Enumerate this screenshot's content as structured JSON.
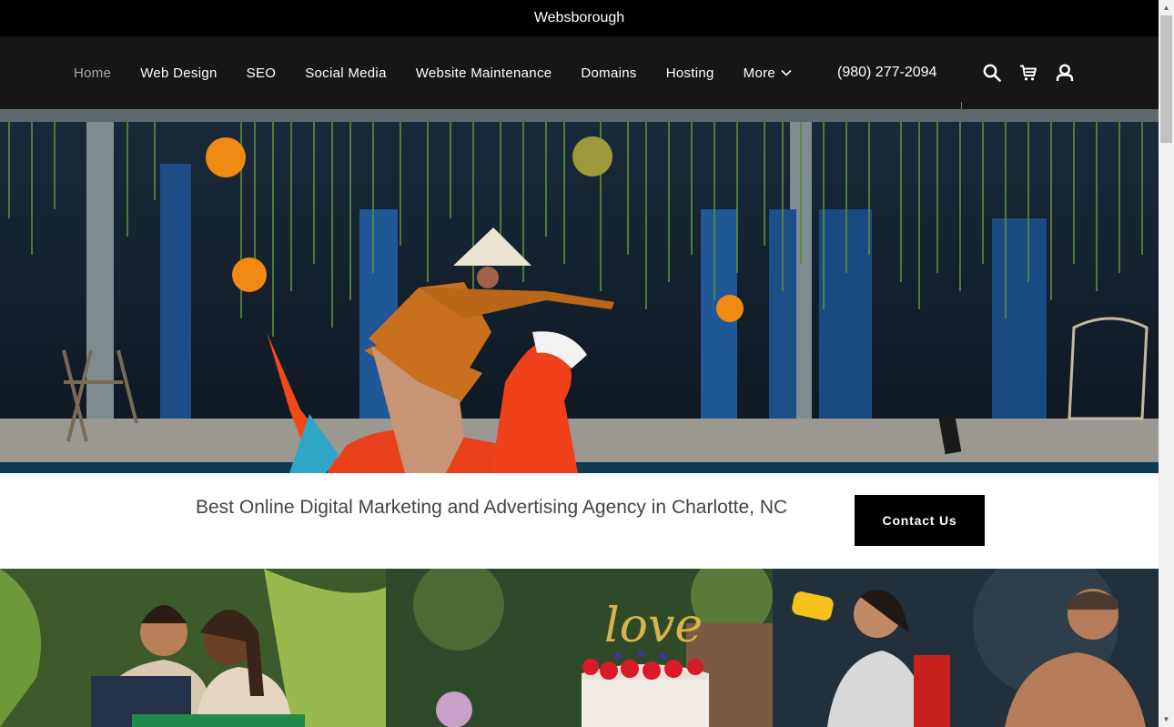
{
  "site_title": "Websborough",
  "nav": {
    "items": [
      {
        "label": "Home",
        "active": true
      },
      {
        "label": "Web Design"
      },
      {
        "label": "SEO"
      },
      {
        "label": "Social Media"
      },
      {
        "label": "Website Maintenance"
      },
      {
        "label": "Domains"
      },
      {
        "label": "Hosting"
      }
    ],
    "more_label": "More",
    "phone": "(980) 277-2094",
    "icons": [
      "search-icon",
      "cart-icon",
      "account-icon"
    ]
  },
  "hero": {
    "image": "hero-photo"
  },
  "intro": {
    "tagline": "Best Online Digital Marketing and Advertising Agency in Charlotte, NC",
    "contact_label": "Contact Us"
  },
  "tiles": [
    {
      "image": "small-business-owners-photo"
    },
    {
      "image": "love-cake-photo",
      "cake_topper": "love"
    },
    {
      "image": "fitness-photo"
    }
  ],
  "colors": {
    "top_bar": "#000000",
    "nav_bg": "#161616",
    "button_bg": "#000000",
    "active_link": "#a8a8a8"
  }
}
